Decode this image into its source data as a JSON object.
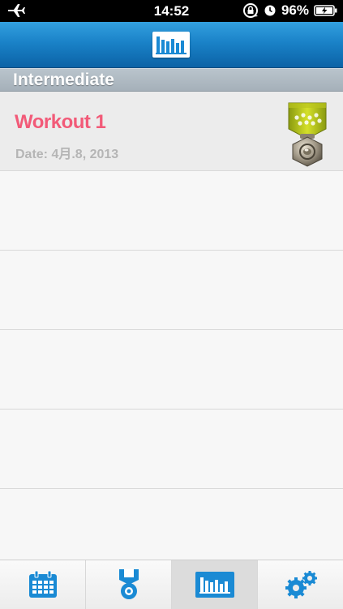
{
  "status_bar": {
    "time": "14:52",
    "battery_percent": "96%",
    "icons": [
      "airplane-icon",
      "rotation-lock-icon",
      "alarm-icon",
      "battery-charging-icon"
    ]
  },
  "nav_bar": {
    "logo_icon": "bar-chart-icon"
  },
  "section": {
    "title": "Intermediate"
  },
  "workouts": [
    {
      "title": "Workout 1",
      "date": "Date: 4月.8, 2013",
      "badge_icon": "medal-icon"
    }
  ],
  "empty_rows": 5,
  "tabs": [
    {
      "name": "tab-calendar",
      "icon": "calendar-icon",
      "active": false
    },
    {
      "name": "tab-medals",
      "icon": "medal-icon",
      "active": false
    },
    {
      "name": "tab-stats",
      "icon": "bar-chart-icon",
      "active": true
    },
    {
      "name": "tab-settings",
      "icon": "gears-icon",
      "active": false
    }
  ],
  "colors": {
    "accent_blue": "#1a8ad4",
    "workout_title": "#f25a78",
    "date_text": "#b5b5b5"
  }
}
